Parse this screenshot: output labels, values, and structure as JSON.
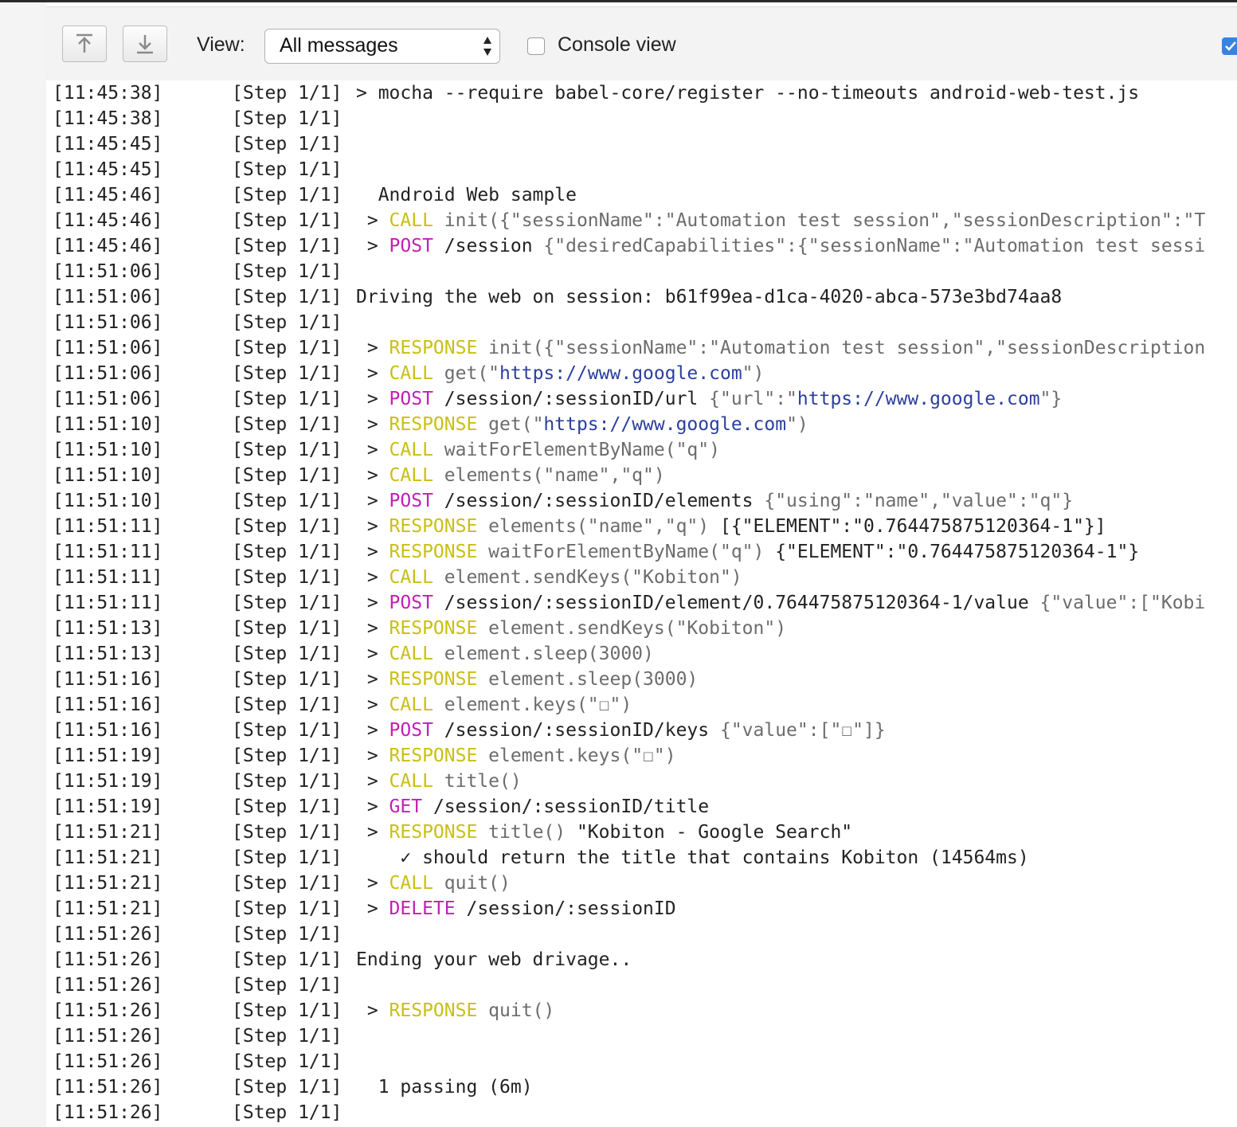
{
  "toolbar": {
    "upload_icon": "arrow-up-to-line-icon",
    "download_icon": "arrow-down-to-line-icon",
    "view_label": "View:",
    "view_selected": "All messages",
    "console_view_label": "Console view",
    "console_view_checked": false,
    "right_checkbox_checked": true
  },
  "colors": {
    "keyword": "#c9bf14",
    "http_method": "#c21fb4",
    "url": "#2a3f9e",
    "dim": "#6c6c6c"
  },
  "log": [
    {
      "ts": "[11:45:38]",
      "step": "[Step 1/1]",
      "parts": [
        {
          "t": "> mocha --require babel-core/register --no-timeouts android-web-test.js",
          "c": ""
        }
      ]
    },
    {
      "ts": "[11:45:38]",
      "step": "[Step 1/1]",
      "parts": []
    },
    {
      "ts": "[11:45:45]",
      "step": "[Step 1/1]",
      "parts": []
    },
    {
      "ts": "[11:45:45]",
      "step": "[Step 1/1]",
      "parts": []
    },
    {
      "ts": "[11:45:46]",
      "step": "[Step 1/1]",
      "parts": [
        {
          "t": "  Android Web sample",
          "c": ""
        }
      ]
    },
    {
      "ts": "[11:45:46]",
      "step": "[Step 1/1]",
      "parts": [
        {
          "t": " > ",
          "c": ""
        },
        {
          "t": "CALL",
          "c": "kw-call"
        },
        {
          "t": " init({\"sessionName\":\"Automation test session\",\"sessionDescription\":\"T",
          "c": "dim"
        }
      ]
    },
    {
      "ts": "[11:45:46]",
      "step": "[Step 1/1]",
      "parts": [
        {
          "t": " > ",
          "c": ""
        },
        {
          "t": "POST",
          "c": "kw-http"
        },
        {
          "t": " /session ",
          "c": ""
        },
        {
          "t": "{\"desiredCapabilities\":{\"sessionName\":\"Automation test sessi",
          "c": "dim"
        }
      ]
    },
    {
      "ts": "[11:51:06]",
      "step": "[Step 1/1]",
      "parts": []
    },
    {
      "ts": "[11:51:06]",
      "step": "[Step 1/1]",
      "parts": [
        {
          "t": "Driving the web on session: b61f99ea-d1ca-4020-abca-573e3bd74aa8",
          "c": ""
        }
      ]
    },
    {
      "ts": "[11:51:06]",
      "step": "[Step 1/1]",
      "parts": []
    },
    {
      "ts": "[11:51:06]",
      "step": "[Step 1/1]",
      "parts": [
        {
          "t": " > ",
          "c": ""
        },
        {
          "t": "RESPONSE",
          "c": "kw-response"
        },
        {
          "t": " init({\"sessionName\":\"Automation test session\",\"sessionDescription",
          "c": "dim"
        }
      ]
    },
    {
      "ts": "[11:51:06]",
      "step": "[Step 1/1]",
      "parts": [
        {
          "t": " > ",
          "c": ""
        },
        {
          "t": "CALL",
          "c": "kw-call"
        },
        {
          "t": " get(\"",
          "c": "dim"
        },
        {
          "t": "https://www.google.com",
          "c": "url"
        },
        {
          "t": "\")",
          "c": "dim"
        }
      ]
    },
    {
      "ts": "[11:51:06]",
      "step": "[Step 1/1]",
      "parts": [
        {
          "t": " > ",
          "c": ""
        },
        {
          "t": "POST",
          "c": "kw-http"
        },
        {
          "t": " /session/:sessionID/url ",
          "c": ""
        },
        {
          "t": "{\"url\":\"",
          "c": "dim"
        },
        {
          "t": "https://www.google.com",
          "c": "url"
        },
        {
          "t": "\"}",
          "c": "dim"
        }
      ]
    },
    {
      "ts": "[11:51:10]",
      "step": "[Step 1/1]",
      "parts": [
        {
          "t": " > ",
          "c": ""
        },
        {
          "t": "RESPONSE",
          "c": "kw-response"
        },
        {
          "t": " get(\"",
          "c": "dim"
        },
        {
          "t": "https://www.google.com",
          "c": "url"
        },
        {
          "t": "\")",
          "c": "dim"
        }
      ]
    },
    {
      "ts": "[11:51:10]",
      "step": "[Step 1/1]",
      "parts": [
        {
          "t": " > ",
          "c": ""
        },
        {
          "t": "CALL",
          "c": "kw-call"
        },
        {
          "t": " waitForElementByName(\"q\")",
          "c": "dim"
        }
      ]
    },
    {
      "ts": "[11:51:10]",
      "step": "[Step 1/1]",
      "parts": [
        {
          "t": " > ",
          "c": ""
        },
        {
          "t": "CALL",
          "c": "kw-call"
        },
        {
          "t": " elements(\"name\",\"q\")",
          "c": "dim"
        }
      ]
    },
    {
      "ts": "[11:51:10]",
      "step": "[Step 1/1]",
      "parts": [
        {
          "t": " > ",
          "c": ""
        },
        {
          "t": "POST",
          "c": "kw-http"
        },
        {
          "t": " /session/:sessionID/elements ",
          "c": ""
        },
        {
          "t": "{\"using\":\"name\",\"value\":\"q\"}",
          "c": "dim"
        }
      ]
    },
    {
      "ts": "[11:51:11]",
      "step": "[Step 1/1]",
      "parts": [
        {
          "t": " > ",
          "c": ""
        },
        {
          "t": "RESPONSE",
          "c": "kw-response"
        },
        {
          "t": " elements(\"name\",\"q\") ",
          "c": "dim"
        },
        {
          "t": "[{\"ELEMENT\":\"0.764475875120364-1\"}]",
          "c": ""
        }
      ]
    },
    {
      "ts": "[11:51:11]",
      "step": "[Step 1/1]",
      "parts": [
        {
          "t": " > ",
          "c": ""
        },
        {
          "t": "RESPONSE",
          "c": "kw-response"
        },
        {
          "t": " waitForElementByName(\"q\") ",
          "c": "dim"
        },
        {
          "t": "{\"ELEMENT\":\"0.764475875120364-1\"}",
          "c": ""
        }
      ]
    },
    {
      "ts": "[11:51:11]",
      "step": "[Step 1/1]",
      "parts": [
        {
          "t": " > ",
          "c": ""
        },
        {
          "t": "CALL",
          "c": "kw-call"
        },
        {
          "t": " element.sendKeys(\"Kobiton\")",
          "c": "dim"
        }
      ]
    },
    {
      "ts": "[11:51:11]",
      "step": "[Step 1/1]",
      "parts": [
        {
          "t": " > ",
          "c": ""
        },
        {
          "t": "POST",
          "c": "kw-http"
        },
        {
          "t": " /session/:sessionID/element/0.764475875120364-1/value ",
          "c": ""
        },
        {
          "t": "{\"value\":[\"Kobi",
          "c": "dim"
        }
      ]
    },
    {
      "ts": "[11:51:13]",
      "step": "[Step 1/1]",
      "parts": [
        {
          "t": " > ",
          "c": ""
        },
        {
          "t": "RESPONSE",
          "c": "kw-response"
        },
        {
          "t": " element.sendKeys(\"Kobiton\")",
          "c": "dim"
        }
      ]
    },
    {
      "ts": "[11:51:13]",
      "step": "[Step 1/1]",
      "parts": [
        {
          "t": " > ",
          "c": ""
        },
        {
          "t": "CALL",
          "c": "kw-call"
        },
        {
          "t": " element.sleep(3000)",
          "c": "dim"
        }
      ]
    },
    {
      "ts": "[11:51:16]",
      "step": "[Step 1/1]",
      "parts": [
        {
          "t": " > ",
          "c": ""
        },
        {
          "t": "RESPONSE",
          "c": "kw-response"
        },
        {
          "t": " element.sleep(3000)",
          "c": "dim"
        }
      ]
    },
    {
      "ts": "[11:51:16]",
      "step": "[Step 1/1]",
      "parts": [
        {
          "t": " > ",
          "c": ""
        },
        {
          "t": "CALL",
          "c": "kw-call"
        },
        {
          "t": " element.keys(\"☐\")",
          "c": "dim"
        }
      ]
    },
    {
      "ts": "[11:51:16]",
      "step": "[Step 1/1]",
      "parts": [
        {
          "t": " > ",
          "c": ""
        },
        {
          "t": "POST",
          "c": "kw-http"
        },
        {
          "t": " /session/:sessionID/keys ",
          "c": ""
        },
        {
          "t": "{\"value\":[\"☐\"]}",
          "c": "dim"
        }
      ]
    },
    {
      "ts": "[11:51:19]",
      "step": "[Step 1/1]",
      "parts": [
        {
          "t": " > ",
          "c": ""
        },
        {
          "t": "RESPONSE",
          "c": "kw-response"
        },
        {
          "t": " element.keys(\"☐\")",
          "c": "dim"
        }
      ]
    },
    {
      "ts": "[11:51:19]",
      "step": "[Step 1/1]",
      "parts": [
        {
          "t": " > ",
          "c": ""
        },
        {
          "t": "CALL",
          "c": "kw-call"
        },
        {
          "t": " title()",
          "c": "dim"
        }
      ]
    },
    {
      "ts": "[11:51:19]",
      "step": "[Step 1/1]",
      "parts": [
        {
          "t": " > ",
          "c": ""
        },
        {
          "t": "GET",
          "c": "kw-http"
        },
        {
          "t": " /session/:sessionID/title",
          "c": ""
        }
      ]
    },
    {
      "ts": "[11:51:21]",
      "step": "[Step 1/1]",
      "parts": [
        {
          "t": " > ",
          "c": ""
        },
        {
          "t": "RESPONSE",
          "c": "kw-response"
        },
        {
          "t": " title() ",
          "c": "dim"
        },
        {
          "t": "\"Kobiton - Google Search\"",
          "c": ""
        }
      ]
    },
    {
      "ts": "[11:51:21]",
      "step": "[Step 1/1]",
      "parts": [
        {
          "t": "    ✓ should return the title that contains Kobiton (14564ms)",
          "c": ""
        }
      ]
    },
    {
      "ts": "[11:51:21]",
      "step": "[Step 1/1]",
      "parts": [
        {
          "t": " > ",
          "c": ""
        },
        {
          "t": "CALL",
          "c": "kw-call"
        },
        {
          "t": " quit()",
          "c": "dim"
        }
      ]
    },
    {
      "ts": "[11:51:21]",
      "step": "[Step 1/1]",
      "parts": [
        {
          "t": " > ",
          "c": ""
        },
        {
          "t": "DELETE",
          "c": "kw-http"
        },
        {
          "t": " /session/:sessionID",
          "c": ""
        }
      ]
    },
    {
      "ts": "[11:51:26]",
      "step": "[Step 1/1]",
      "parts": []
    },
    {
      "ts": "[11:51:26]",
      "step": "[Step 1/1]",
      "parts": [
        {
          "t": "Ending your web drivage..",
          "c": ""
        }
      ]
    },
    {
      "ts": "[11:51:26]",
      "step": "[Step 1/1]",
      "parts": []
    },
    {
      "ts": "[11:51:26]",
      "step": "[Step 1/1]",
      "parts": [
        {
          "t": " > ",
          "c": ""
        },
        {
          "t": "RESPONSE",
          "c": "kw-response"
        },
        {
          "t": " quit()",
          "c": "dim"
        }
      ]
    },
    {
      "ts": "[11:51:26]",
      "step": "[Step 1/1]",
      "parts": []
    },
    {
      "ts": "[11:51:26]",
      "step": "[Step 1/1]",
      "parts": []
    },
    {
      "ts": "[11:51:26]",
      "step": "[Step 1/1]",
      "parts": [
        {
          "t": "  1 passing (6m)",
          "c": ""
        }
      ]
    },
    {
      "ts": "[11:51:26]",
      "step": "[Step 1/1]",
      "parts": []
    }
  ]
}
